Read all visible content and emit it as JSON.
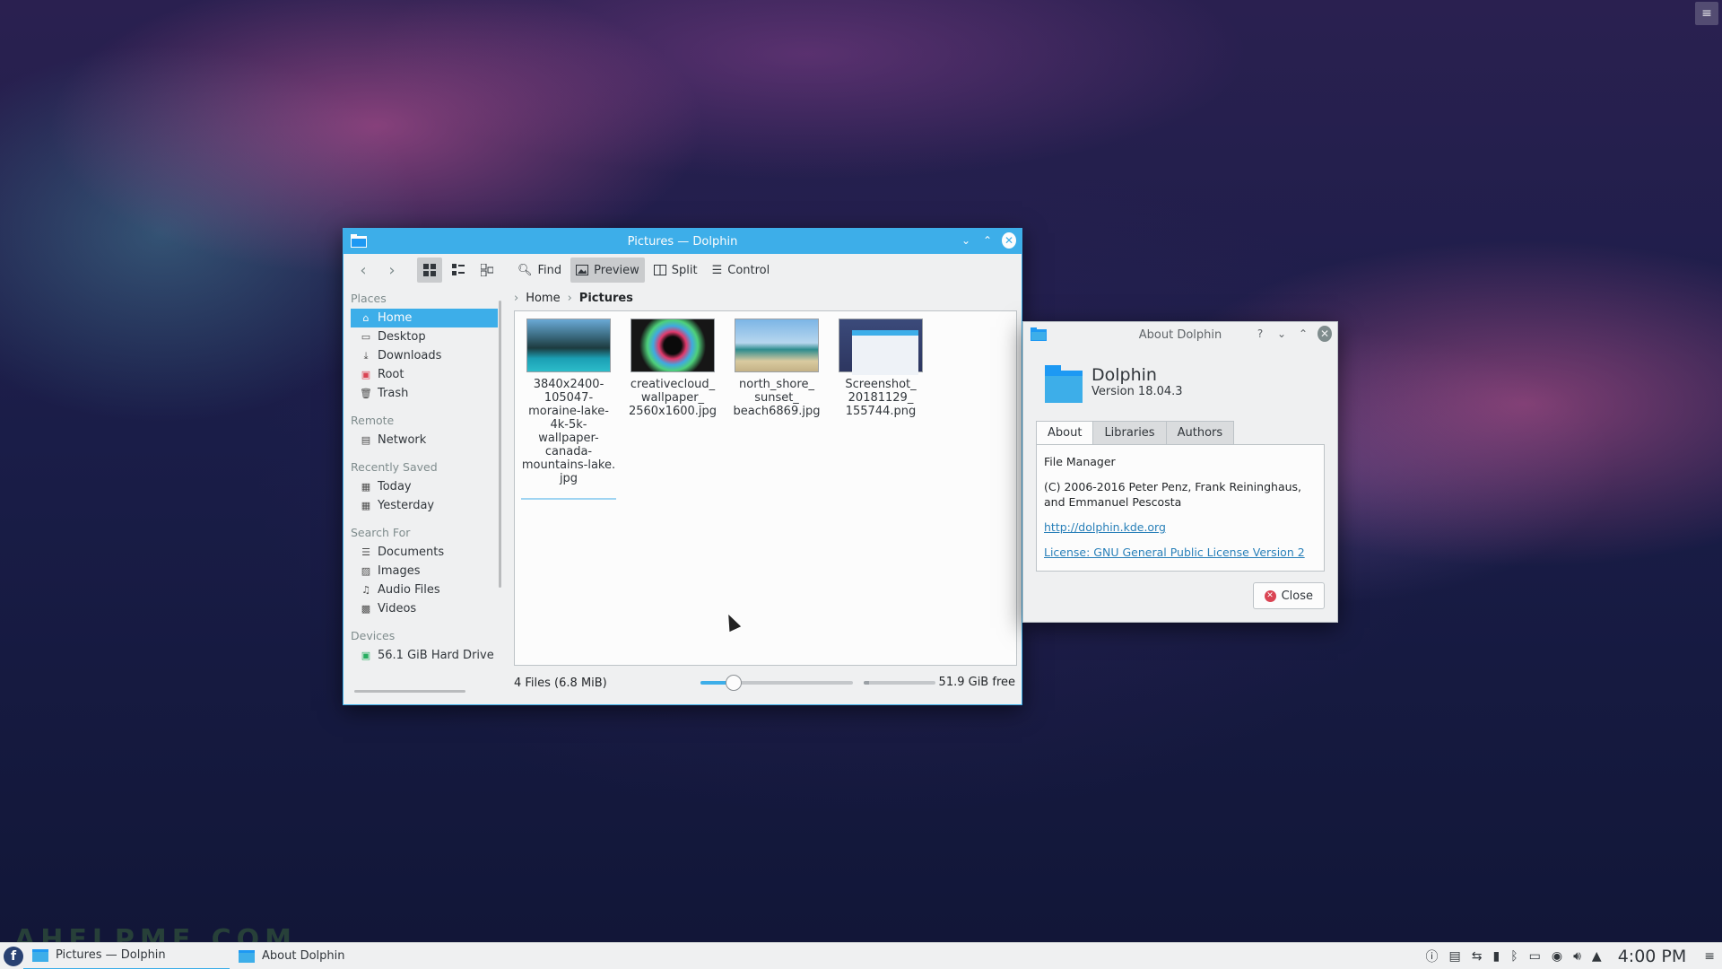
{
  "colors": {
    "accent": "#3daee9",
    "window_bg": "#eff0f1",
    "view_bg": "#fcfcfc",
    "close_red": "#da4453"
  },
  "dolphin": {
    "title": "Pictures — Dolphin",
    "toolbar": {
      "back": "back-icon",
      "forward": "forward-icon",
      "find": "Find",
      "preview": "Preview",
      "split": "Split",
      "control": "Control"
    },
    "places": {
      "sections": {
        "places": "Places",
        "remote": "Remote",
        "recently_saved": "Recently Saved",
        "search_for": "Search For",
        "devices": "Devices"
      },
      "items": {
        "home": "Home",
        "desktop": "Desktop",
        "downloads": "Downloads",
        "root": "Root",
        "trash": "Trash",
        "network": "Network",
        "today": "Today",
        "yesterday": "Yesterday",
        "documents": "Documents",
        "images": "Images",
        "audio_files": "Audio Files",
        "videos": "Videos",
        "hard_drive": "56.1 GiB Hard Drive"
      }
    },
    "breadcrumb": {
      "home": "Home",
      "current": "Pictures"
    },
    "files": [
      {
        "name": "3840x2400-105047-moraine-lake-4k-5k-wallpaper-canada-mountains-lake.jpg",
        "lines": [
          "3840x2400-",
          "105047-",
          "moraine-lake-",
          "4k-5k-",
          "wallpaper-",
          "canada-",
          "mountains-lake.",
          "jpg"
        ]
      },
      {
        "name": "creativecloud_wallpaper_2560x1600.jpg",
        "lines": [
          "creativecloud_",
          "wallpaper_",
          "2560x1600.jpg"
        ]
      },
      {
        "name": "north_shore_sunset_beach6869.jpg",
        "lines": [
          "north_shore_",
          "sunset_",
          "beach6869.jpg"
        ]
      },
      {
        "name": "Screenshot_20181129_155744.png",
        "lines": [
          "Screenshot_",
          "20181129_",
          "155744.png"
        ]
      }
    ],
    "status": {
      "summary": "4 Files (6.8 MiB)",
      "free": "51.9 GiB free",
      "zoom_level": 0.22,
      "used_fraction": 0.08
    }
  },
  "about": {
    "title": "About Dolphin",
    "app_name": "Dolphin",
    "version": "Version 18.04.3",
    "tabs": [
      "About",
      "Libraries",
      "Authors"
    ],
    "description": "File Manager",
    "copyright": "(C) 2006-2016 Peter Penz, Frank Reininghaus, and Emmanuel Pescosta",
    "url": "http://dolphin.kde.org",
    "license": "License: GNU General Public License Version 2",
    "close": "Close"
  },
  "taskbar": {
    "tasks": [
      "Pictures — Dolphin",
      "About Dolphin"
    ],
    "clock": "4:00 PM"
  },
  "watermark": "AHELPME.COM"
}
